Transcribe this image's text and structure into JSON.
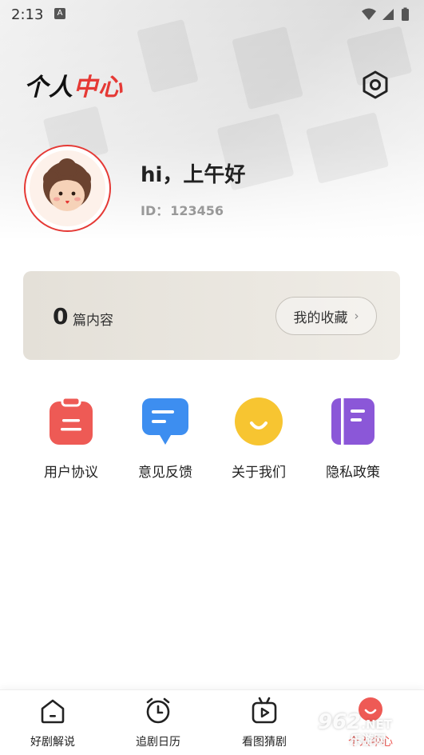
{
  "status_bar": {
    "time": "2:13",
    "notification_badge": "A"
  },
  "header": {
    "title_part1": "个人",
    "title_part2": "中心"
  },
  "profile": {
    "greeting": "hi，上午好",
    "id_label": "ID：",
    "id_value": "123456"
  },
  "content_card": {
    "count": "0",
    "count_label": "篇内容",
    "favorites_label": "我的收藏",
    "chevron": "›"
  },
  "grid": [
    {
      "label": "用户协议",
      "icon": "clipboard-icon",
      "color": "#ee5a55"
    },
    {
      "label": "意见反馈",
      "icon": "chat-bubble-icon",
      "color": "#3d8ef0"
    },
    {
      "label": "关于我们",
      "icon": "smile-icon",
      "color": "#f7c531"
    },
    {
      "label": "隐私政策",
      "icon": "book-icon",
      "color": "#8b57d8"
    }
  ],
  "bottom_nav": [
    {
      "label": "好剧解说",
      "icon": "home-icon"
    },
    {
      "label": "追剧日历",
      "icon": "alarm-clock-icon"
    },
    {
      "label": "看图猜剧",
      "icon": "tv-play-icon"
    },
    {
      "label": "个人中心",
      "icon": "smile-circle-icon",
      "active": true
    }
  ],
  "watermark": {
    "text": "962",
    "sub": ".NET",
    "cn": "乐游网"
  },
  "colors": {
    "accent": "#e53935",
    "card_bg": "#ebe7e0"
  }
}
